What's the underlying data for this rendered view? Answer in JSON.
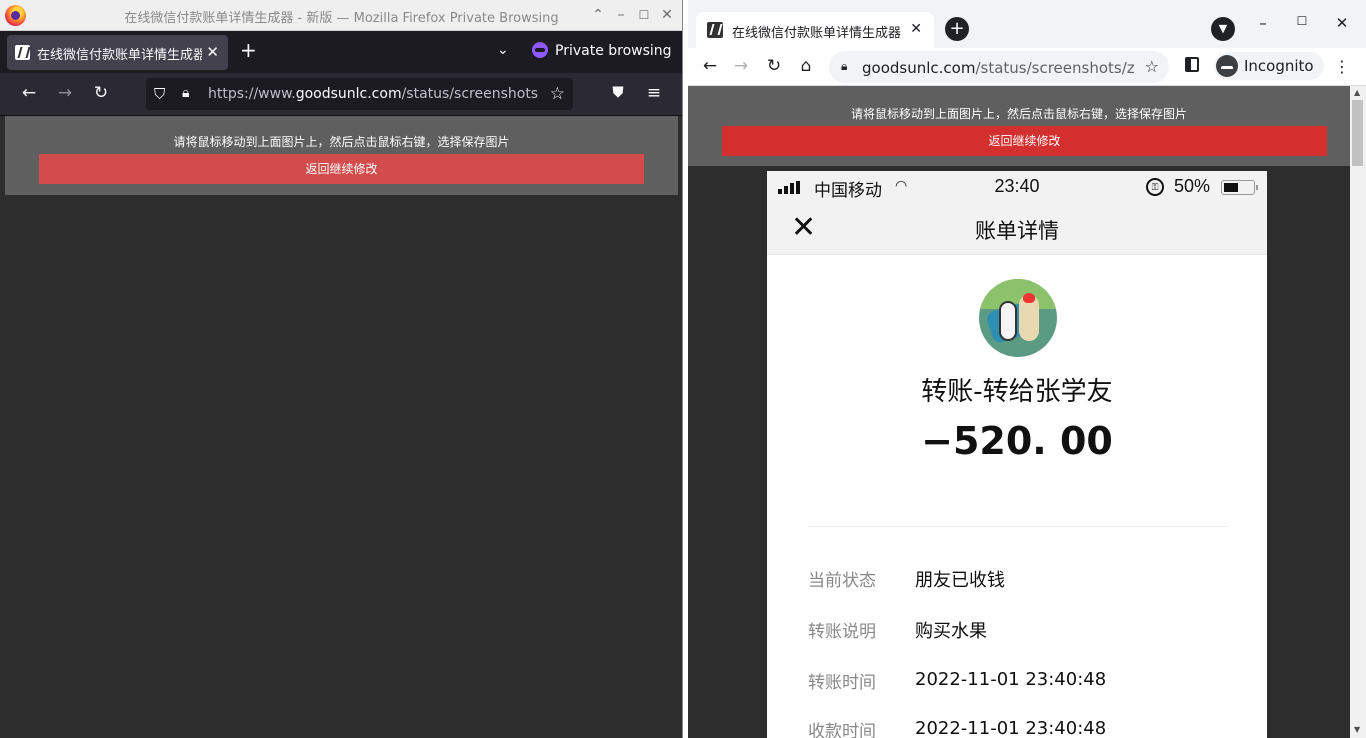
{
  "firefox": {
    "window_title": "在线微信付款账单详情生成器 - 新版 — Mozilla Firefox Private Browsing",
    "tab_title": "在线微信付款账单详情生成器",
    "private_label": "Private browsing",
    "url_prefix": "https://www.",
    "url_domain": "goodsunlc.com",
    "url_path": "/status/screenshots/",
    "hint": "请将鼠标移动到上面图片上，然后点击鼠标右键，选择保存图片",
    "back_button": "返回继续修改"
  },
  "chrome": {
    "tab_title": "在线微信付款账单详情生成器",
    "url_domain": "goodsunlc.com",
    "url_path": "/status/screenshots/z...",
    "incognito_label": "Incognito",
    "hint": "请将鼠标移动到上面图片上，然后点击鼠标右键，选择保存图片",
    "back_button": "返回继续修改"
  },
  "receipt": {
    "carrier": "中国移动",
    "time": "23:40",
    "battery": "50%",
    "battery_level": 0.5,
    "header_title": "账单详情",
    "title": "转账-转给张学友",
    "amount": "−520. 00",
    "rows": [
      {
        "label": "当前状态",
        "value": "朋友已收钱"
      },
      {
        "label": "转账说明",
        "value": "购买水果"
      },
      {
        "label": "转账时间",
        "value": "2022-11-01 23:40:48"
      },
      {
        "label": "收款时间",
        "value": "2022-11-01 23:40:48"
      }
    ]
  }
}
